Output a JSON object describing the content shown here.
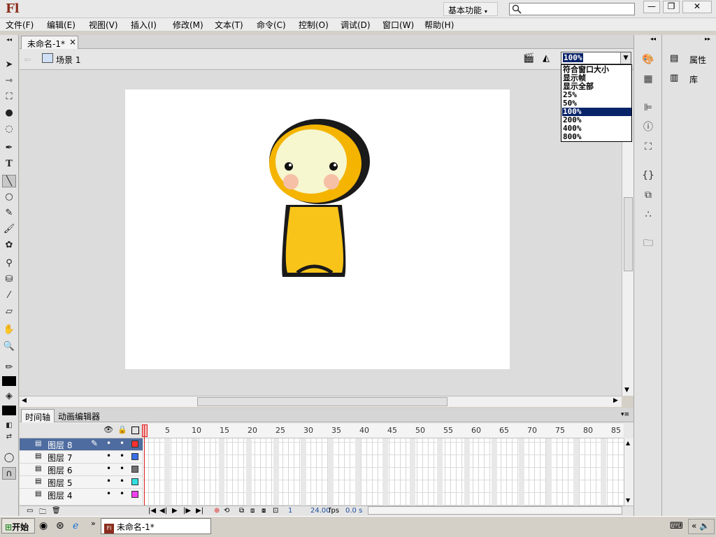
{
  "app": {
    "logo": "Fl",
    "workspace_label": "基本功能",
    "search_placeholder": ""
  },
  "menu": [
    "文件(F)",
    "编辑(E)",
    "视图(V)",
    "插入(I)",
    "修改(M)",
    "文本(T)",
    "命令(C)",
    "控制(O)",
    "调试(D)",
    "窗口(W)",
    "帮助(H)"
  ],
  "document": {
    "tab_title": "未命名-1*",
    "tab_close": "×",
    "scene_label": "场景 1"
  },
  "zoom": {
    "value": "100%",
    "options": [
      "符合窗口大小",
      "显示帧",
      "显示全部",
      "25%",
      "50%",
      "100%",
      "200%",
      "400%",
      "800%"
    ],
    "selected_index": 5
  },
  "right_panel": {
    "items": [
      "属性",
      "库"
    ]
  },
  "timeline": {
    "tabs": [
      "时间轴",
      "动画编辑器"
    ],
    "ruler": [
      "5",
      "10",
      "15",
      "20",
      "25",
      "30",
      "35",
      "40",
      "45",
      "50",
      "55",
      "60",
      "65",
      "70",
      "75",
      "80",
      "85"
    ],
    "layers": [
      {
        "name": "图层 8",
        "color": "#ff3030",
        "active": true
      },
      {
        "name": "图层 7",
        "color": "#3870e8",
        "active": false
      },
      {
        "name": "图层 6",
        "color": "#707070",
        "active": false
      },
      {
        "name": "图层 5",
        "color": "#30e0e0",
        "active": false
      },
      {
        "name": "图层 4",
        "color": "#f040f0",
        "active": false
      }
    ],
    "current_frame": "1",
    "fps": "24.00",
    "fps_unit": "fps",
    "time": "0.0 s"
  },
  "taskbar": {
    "start_label": "开始",
    "window_label": "未命名-1*"
  },
  "colors": {
    "stage": "#ffffff",
    "selection": "#0a246a",
    "active_layer": "#4e6c9f"
  }
}
